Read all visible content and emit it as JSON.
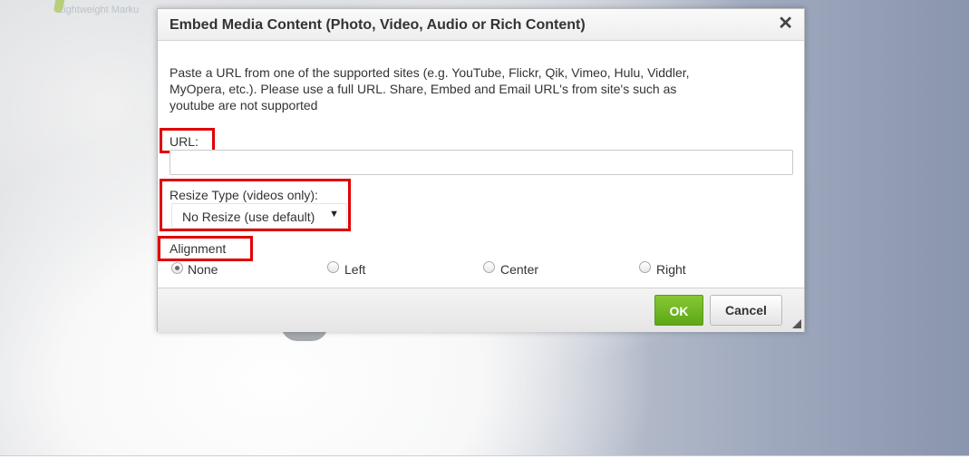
{
  "background": {
    "logo_text": "Lightweight Marku"
  },
  "dialog": {
    "title": "Embed Media Content (Photo, Video, Audio or Rich Content)",
    "close_symbol": "✕",
    "description": "Paste a URL from one of the supported sites (e.g. YouTube, Flickr, Qik, Vimeo, Hulu, Viddler, MyOpera, etc.). Please use a full URL. Share, Embed and Email URL's from site's such as youtube are not supported",
    "url": {
      "label": "URL:",
      "value": "",
      "placeholder": ""
    },
    "resize": {
      "label": "Resize Type (videos only):",
      "selected": "No Resize (use default)",
      "arrow": "▼"
    },
    "alignment": {
      "label": "Alignment",
      "options": [
        "None",
        "Left",
        "Center",
        "Right"
      ],
      "selected": "None"
    },
    "buttons": {
      "ok": "OK",
      "cancel": "Cancel"
    }
  },
  "colors": {
    "highlight": "#e00000",
    "ok_green": "#6cb523"
  }
}
